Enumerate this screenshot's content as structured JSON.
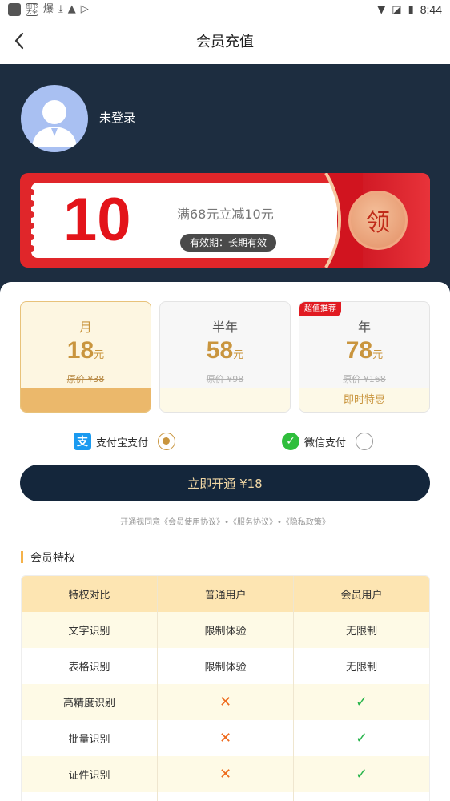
{
  "status_bar": {
    "time": "8:44",
    "app_icon_text": "图书\n大全",
    "glyph": "爆"
  },
  "header": {
    "title": "会员充值"
  },
  "user": {
    "name": "未登录"
  },
  "coupon": {
    "amount": "10",
    "description": "满68元立减10元",
    "validity": "有效期：长期有效",
    "claim_label": "领"
  },
  "plans": [
    {
      "name": "月",
      "price": "18",
      "unit": "元",
      "original": "原价 ¥38",
      "footer": "",
      "badge": "",
      "selected": true
    },
    {
      "name": "半年",
      "price": "58",
      "unit": "元",
      "original": "原价 ¥98",
      "footer": "",
      "badge": "",
      "selected": false
    },
    {
      "name": "年",
      "price": "78",
      "unit": "元",
      "original": "原价 ¥168",
      "footer": "即时特惠",
      "badge": "超值推荐",
      "selected": false
    }
  ],
  "payment": {
    "alipay": {
      "label": "支付宝支付",
      "icon": "alipay-icon",
      "selected": true
    },
    "wechat": {
      "label": "微信支付",
      "icon": "wechat-pay-icon",
      "selected": false
    }
  },
  "cta": {
    "label": "立即开通 ¥18"
  },
  "agreement": "开通视同意《会员使用协议》•《服务协议》•《隐私政策》",
  "privileges": {
    "title": "会员特权",
    "headers": [
      "特权对比",
      "普通用户",
      "会员用户"
    ],
    "rows": [
      [
        "文字识别",
        "限制体验",
        "无限制"
      ],
      [
        "表格识别",
        "限制体验",
        "无限制"
      ],
      [
        "高精度识别",
        "✕",
        "✓"
      ],
      [
        "批量识别",
        "✕",
        "✓"
      ],
      [
        "证件识别",
        "✕",
        "✓"
      ]
    ]
  },
  "colors": {
    "dark_band": "#1d2d40",
    "gold": "#c9953e",
    "coupon_red": "#e0262a"
  }
}
